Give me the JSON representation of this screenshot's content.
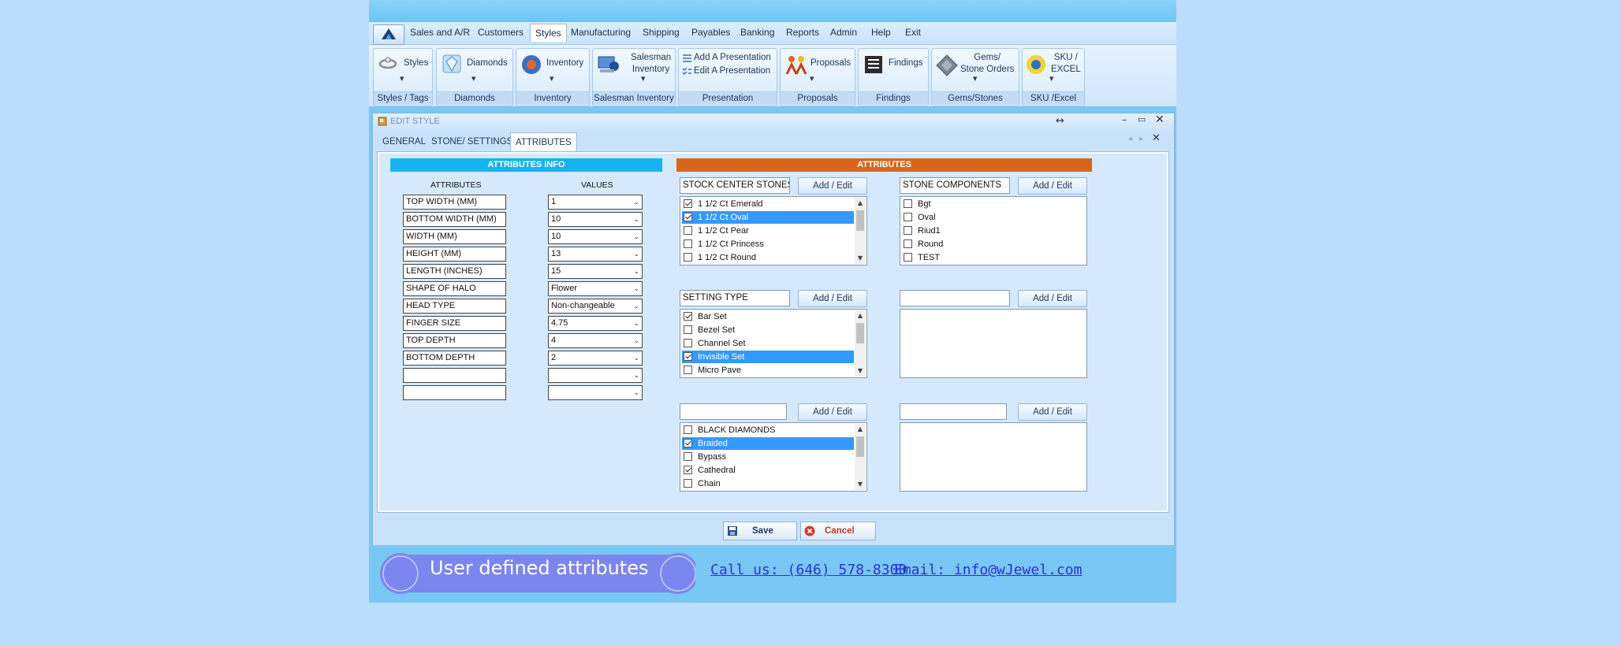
{
  "menu": {
    "items": [
      "Sales and A/R",
      "Customers",
      "Styles",
      "Manufacturing",
      "Shipping",
      "Payables",
      "Banking",
      "Reports",
      "Admin",
      "Help",
      "Exit"
    ],
    "active": "Styles"
  },
  "ribbon": {
    "groups": [
      {
        "buttons": [
          "Styles"
        ],
        "label": "Styles / Tags"
      },
      {
        "buttons": [
          "Diamonds"
        ],
        "label": "Diamonds"
      },
      {
        "buttons": [
          "Inventory"
        ],
        "label": "Inventory"
      },
      {
        "buttons": [
          "Salesman\nInventory"
        ],
        "label": "Salesman Inventory"
      },
      {
        "buttons": [
          "Add A Presentation",
          "Edit A Presentation"
        ],
        "label": "Presentation"
      },
      {
        "buttons": [
          "Proposals"
        ],
        "label": "Proposals"
      },
      {
        "buttons": [
          "Findings"
        ],
        "label": "Findings"
      },
      {
        "buttons": [
          "Gems/\nStone Orders"
        ],
        "label": "Gems/Stones"
      },
      {
        "buttons": [
          "SKU /\nEXCEL"
        ],
        "label": "SKU /Excel"
      }
    ]
  },
  "window": {
    "title": "EDIT STYLE",
    "tabs": [
      "GENERAL",
      "STONE/ SETTINGS",
      "ATTRIBUTES"
    ],
    "active_tab": "ATTRIBUTES"
  },
  "attributes_info": {
    "banner": "ATTRIBUTES  INFO",
    "col_attributes": "ATTRIBUTES",
    "col_values": "VALUES",
    "rows": [
      {
        "name": "TOP WIDTH (MM)",
        "value": "1"
      },
      {
        "name": "BOTTOM WIDTH (MM)",
        "value": "10"
      },
      {
        "name": "WIDTH (MM)",
        "value": "10"
      },
      {
        "name": "HEIGHT (MM)",
        "value": "13"
      },
      {
        "name": "LENGTH (INCHES)",
        "value": "15"
      },
      {
        "name": "SHAPE OF HALO",
        "value": "Flower"
      },
      {
        "name": "HEAD TYPE",
        "value": "Non-changeable"
      },
      {
        "name": "FINGER SIZE",
        "value": "4.75"
      },
      {
        "name": "TOP DEPTH",
        "value": "4"
      },
      {
        "name": "BOTTOM DEPTH",
        "value": "2"
      },
      {
        "name": "",
        "value": ""
      },
      {
        "name": "",
        "value": ""
      }
    ]
  },
  "attributes": {
    "banner": "ATTRIBUTES",
    "add_edit_label": "Add / Edit",
    "lists": [
      {
        "title": "STOCK CENTER STONES",
        "items": [
          {
            "label": "1 1/2 Ct Emerald",
            "checked": true,
            "selected": false
          },
          {
            "label": "1 1/2 Ct Oval",
            "checked": true,
            "selected": true
          },
          {
            "label": "1 1/2 Ct Pear",
            "checked": false,
            "selected": false
          },
          {
            "label": "1 1/2 Ct Princess",
            "checked": false,
            "selected": false
          },
          {
            "label": "1 1/2 Ct Round",
            "checked": false,
            "selected": false
          }
        ],
        "scroll": true
      },
      {
        "title": "STONE COMPONENTS",
        "items": [
          {
            "label": "Bgt",
            "checked": false,
            "selected": false
          },
          {
            "label": "Oval",
            "checked": false,
            "selected": false
          },
          {
            "label": "Riud1",
            "checked": false,
            "selected": false
          },
          {
            "label": "Round",
            "checked": false,
            "selected": false
          },
          {
            "label": "TEST",
            "checked": false,
            "selected": false
          }
        ],
        "scroll": false
      },
      {
        "title": "SETTING TYPE",
        "items": [
          {
            "label": "Bar Set",
            "checked": true,
            "selected": false
          },
          {
            "label": "Bezel Set",
            "checked": false,
            "selected": false
          },
          {
            "label": "Channel Set",
            "checked": false,
            "selected": false
          },
          {
            "label": "Invisible Set",
            "checked": true,
            "selected": true
          },
          {
            "label": "Micro Pave",
            "checked": false,
            "selected": false
          }
        ],
        "scroll": true
      },
      {
        "title": "",
        "items": [],
        "scroll": false
      },
      {
        "title": "",
        "items": [
          {
            "label": "BLACK DIAMONDS",
            "checked": false,
            "selected": false
          },
          {
            "label": "Braided",
            "checked": true,
            "selected": true
          },
          {
            "label": "Bypass",
            "checked": false,
            "selected": false
          },
          {
            "label": "Cathedral",
            "checked": true,
            "selected": false
          },
          {
            "label": "Chain",
            "checked": false,
            "selected": false
          }
        ],
        "scroll": true
      },
      {
        "title": "",
        "items": [],
        "scroll": false
      }
    ]
  },
  "footer": {
    "save": "Save",
    "cancel": "Cancel"
  },
  "status": {
    "caption": "User defined attributes",
    "phone": "Call us: (646) 578-8300",
    "email": "Email: info@wJewel.com"
  },
  "colors": {
    "attr_info_banner": "#14b4ee",
    "attr_banner": "#d9641c",
    "selection": "#3399ff",
    "link": "#2a32d6",
    "pill": "#7b86ee"
  }
}
